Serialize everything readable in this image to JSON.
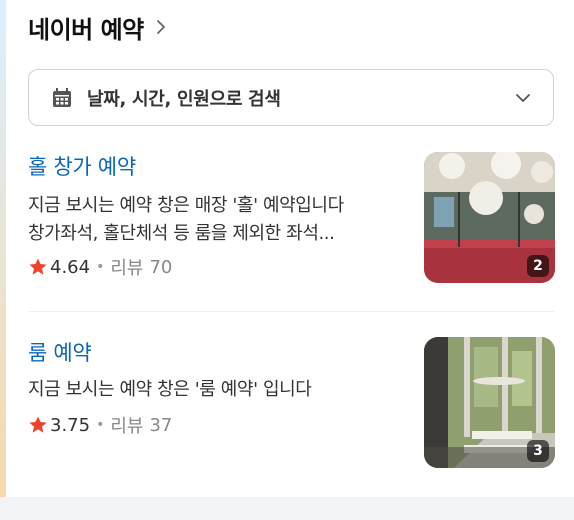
{
  "header": {
    "title": "네이버 예약"
  },
  "search": {
    "label": "날짜, 시간, 인원으로 검색"
  },
  "items": [
    {
      "title": "홀 창가 예약",
      "desc_line1": "지금 보시는 예약 창은 매장 '홀' 예약입니다",
      "desc_line2": "창가좌석, 홀단체석 등 룸을 제외한 좌석...",
      "rating": "4.64",
      "review_label": "리뷰",
      "review_count": "70",
      "photo_count": "2"
    },
    {
      "title": "룸 예약",
      "desc_line1": "지금 보시는 예약 창은 '룸 예약' 입니다",
      "rating": "3.75",
      "review_label": "리뷰",
      "review_count": "37",
      "photo_count": "3"
    }
  ],
  "colors": {
    "link": "#0a67b8",
    "star": "#f0422b",
    "border": "#cfd2d6"
  }
}
